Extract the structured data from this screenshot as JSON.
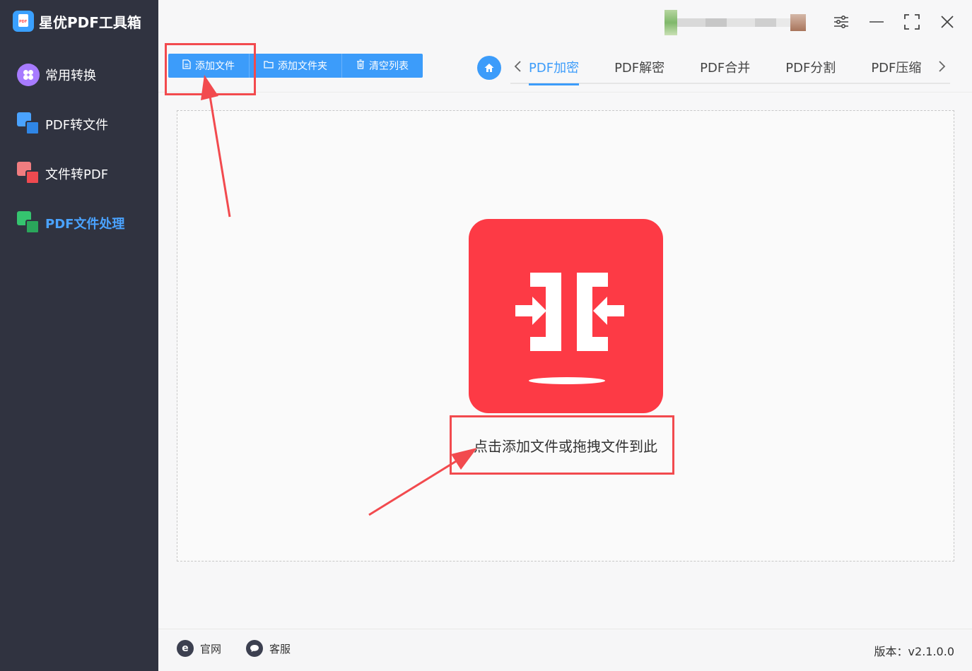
{
  "app": {
    "name": "星优PDF工具箱"
  },
  "sidebar": {
    "items": [
      {
        "label": "常用转换",
        "icon": "grid-flower-icon",
        "active": false
      },
      {
        "label": "PDF转文件",
        "icon": "pdf-to-file-icon",
        "active": false
      },
      {
        "label": "文件转PDF",
        "icon": "file-to-pdf-icon",
        "active": false
      },
      {
        "label": "PDF文件处理",
        "icon": "pdf-process-icon",
        "active": true
      }
    ]
  },
  "toolbar": {
    "add_file": "添加文件",
    "add_folder": "添加文件夹",
    "clear_list": "清空列表"
  },
  "tabs": [
    {
      "label": "PDF加密",
      "active": true
    },
    {
      "label": "PDF解密",
      "active": false
    },
    {
      "label": "PDF合并",
      "active": false
    },
    {
      "label": "PDF分割",
      "active": false
    },
    {
      "label": "PDF压缩",
      "active": false
    }
  ],
  "drop_area": {
    "hint": "点击添加文件或拖拽文件到此"
  },
  "footer": {
    "website": "官网",
    "support": "客服",
    "version": "版本：v2.1.0.0"
  },
  "colors": {
    "sidebar_bg": "#303340",
    "accent": "#3c9cfa",
    "drop_icon": "#fd3a45",
    "annotation": "#f24a4e"
  }
}
